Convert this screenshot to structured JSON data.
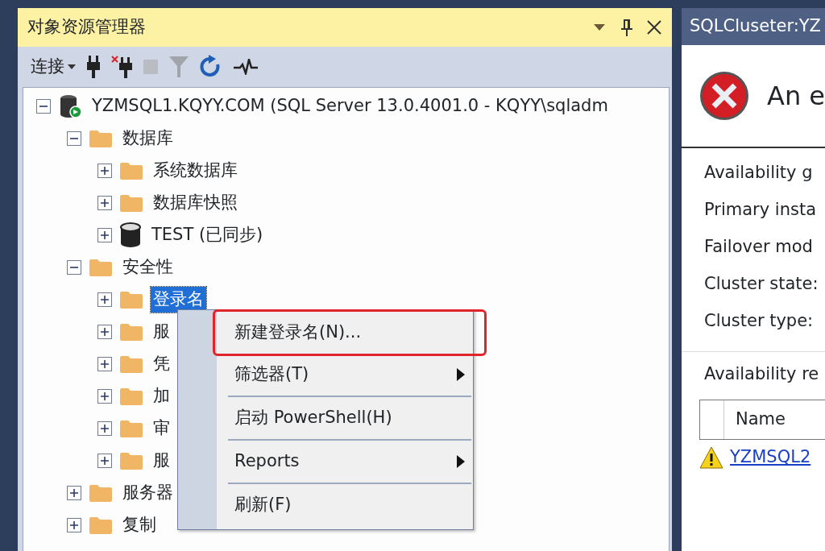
{
  "explorer": {
    "title": "对象资源管理器",
    "toolbar": [
      {
        "kind": "connect",
        "label": "连接",
        "disabled": false
      },
      {
        "kind": "plug",
        "disabled": false
      },
      {
        "kind": "unplug",
        "disabled": false
      },
      {
        "kind": "stop",
        "disabled": true
      },
      {
        "kind": "filter",
        "disabled": true
      },
      {
        "kind": "refresh",
        "disabled": false
      },
      {
        "kind": "activity",
        "disabled": false
      }
    ],
    "tree": [
      {
        "label": "YZMSQL1.KQYY.COM (SQL Server 13.0.4001.0 - KQYY\\sqladm",
        "kind": "server",
        "expanded": true,
        "selected": false,
        "children": [
          {
            "label": "数据库",
            "kind": "folder",
            "expanded": true,
            "selected": false,
            "children": [
              {
                "label": "系统数据库",
                "kind": "folder",
                "expanded": false,
                "selected": false
              },
              {
                "label": "数据库快照",
                "kind": "folder",
                "expanded": false,
                "selected": false
              },
              {
                "label": "TEST (已同步)",
                "kind": "database",
                "expanded": false,
                "selected": false
              }
            ]
          },
          {
            "label": "安全性",
            "kind": "folder",
            "expanded": true,
            "selected": false,
            "children": [
              {
                "label": "登录名",
                "kind": "folder",
                "expanded": false,
                "selected": true
              },
              {
                "label": "服",
                "kind": "folder",
                "expanded": false,
                "selected": false
              },
              {
                "label": "凭",
                "kind": "folder",
                "expanded": false,
                "selected": false
              },
              {
                "label": "加",
                "kind": "folder",
                "expanded": false,
                "selected": false
              },
              {
                "label": "审",
                "kind": "folder",
                "expanded": false,
                "selected": false
              },
              {
                "label": "服",
                "kind": "folder",
                "expanded": false,
                "selected": false
              }
            ]
          },
          {
            "label": "服务器",
            "kind": "folder",
            "expanded": false,
            "selected": false
          },
          {
            "label": "复制",
            "kind": "folder",
            "expanded": false,
            "selected": false
          }
        ]
      }
    ]
  },
  "context_menu": [
    {
      "label": "新建登录名(N)...",
      "submenu": false,
      "separator_before": false,
      "highlighted": true
    },
    {
      "label": "筛选器(T)",
      "submenu": true,
      "separator_before": false,
      "highlighted": false
    },
    {
      "label": "启动 PowerShell(H)",
      "submenu": false,
      "separator_before": true,
      "highlighted": false
    },
    {
      "label": "Reports",
      "submenu": true,
      "separator_before": true,
      "highlighted": false
    },
    {
      "label": "刷新(F)",
      "submenu": false,
      "separator_before": true,
      "highlighted": false
    }
  ],
  "dashboard": {
    "tab_title": "SQLCluseter:YZ",
    "heading": "An e",
    "fields": [
      "Availability g",
      "Primary insta",
      "Failover mod",
      "Cluster state:",
      "Cluster type:"
    ],
    "section_title": "Availability re",
    "table_columns": [
      "Name"
    ],
    "replicas": [
      {
        "name": "YZMSQL2",
        "kind": "warning"
      }
    ]
  }
}
